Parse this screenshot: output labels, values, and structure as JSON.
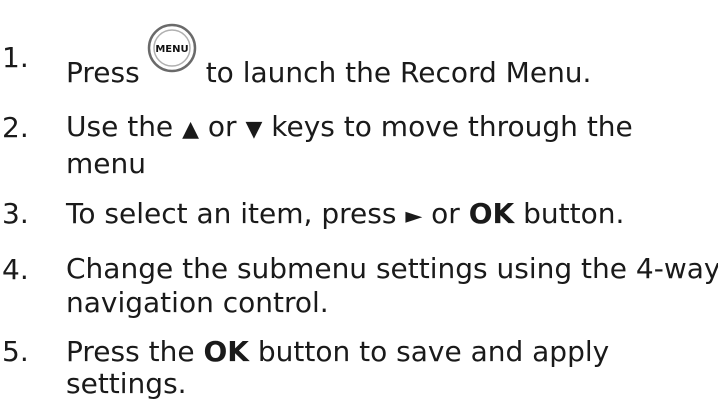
{
  "steps": [
    {
      "number": "1.",
      "text_before": "Press",
      "icon": "menu-button-icon",
      "icon_label": "MENU",
      "text_after": "to launch the Record Menu."
    },
    {
      "number": "2.",
      "line1_a": "Use the",
      "up_key": "▲",
      "line1_b": "or",
      "down_key": "▼",
      "line1_c": "keys to move through the",
      "line2": "menu"
    },
    {
      "number": "3.",
      "text_a": "To select an item, press",
      "right_key": "►",
      "text_b": "or",
      "ok_label": "OK",
      "text_c": "button."
    },
    {
      "number": "4.",
      "line1": "Change the submenu settings using the 4-way",
      "line2": "navigation control."
    },
    {
      "number": "5.",
      "line1_a": "Press the",
      "ok_label": "OK",
      "line1_b": "button to save and apply",
      "line2": "settings."
    }
  ],
  "colors": {
    "text": "#1a1a1a",
    "background": "#ffffff"
  }
}
